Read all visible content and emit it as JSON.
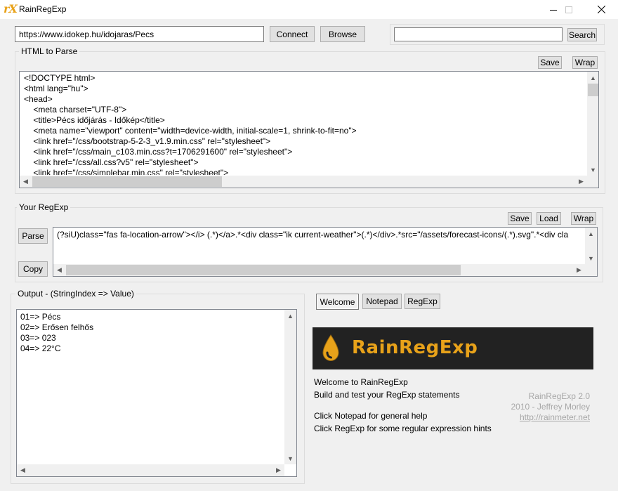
{
  "window": {
    "logo": "rX",
    "title": "RainRegExp"
  },
  "url_bar": {
    "value": "https://www.idokep.hu/idojaras/Pecs",
    "connect_label": "Connect",
    "browse_label": "Browse"
  },
  "search": {
    "value": "",
    "button_label": "Search"
  },
  "html_panel": {
    "label": "HTML to Parse",
    "save_label": "Save",
    "wrap_label": "Wrap",
    "lines": [
      "<!DOCTYPE html>",
      "<html lang=\"hu\">",
      "<head>",
      "    <meta charset=\"UTF-8\">",
      "    <title>Pécs időjárás - Időkép</title>",
      "    <meta name=\"viewport\" content=\"width=device-width, initial-scale=1, shrink-to-fit=no\">",
      "    <link href=\"/css/bootstrap-5-2-3_v1.9.min.css\" rel=\"stylesheet\">",
      "    <link href=\"/css/main_c103.min.css?t=1706291600\" rel=\"stylesheet\">",
      "    <link href=\"/css/all.css?v5\" rel=\"stylesheet\">",
      "    <link href=\"/css/simplebar.min.css\" rel=\"stylesheet\">"
    ]
  },
  "regexp_panel": {
    "label": "Your RegExp",
    "save_label": "Save",
    "load_label": "Load",
    "wrap_label": "Wrap",
    "parse_label": "Parse",
    "copy_label": "Copy",
    "value": "(?siU)class=\"fas fa-location-arrow\"></i> (.*)</a>.*<div class=\"ik current-weather\">(.*)</div>.*src=\"/assets/forecast-icons/(.*).svg\".*<div cla"
  },
  "output_panel": {
    "label": "Output - (StringIndex => Value)",
    "lines": [
      "01=> Pécs",
      "02=> Erősen felhős",
      "03=> 023",
      "04=> 22°C"
    ]
  },
  "tabs": [
    {
      "label": "Welcome"
    },
    {
      "label": "Notepad"
    },
    {
      "label": "RegExp"
    }
  ],
  "welcome": {
    "banner_text": "RainRegExp",
    "line1": "Welcome to RainRegExp",
    "line2": "Build and test your RegExp statements",
    "line3": "Click Notepad for general help",
    "line4": "Click RegExp for some regular expression hints",
    "credit_version": "RainRegExp 2.0",
    "credit_author": "2010 - Jeffrey Morley",
    "credit_link": "http://rainmeter.net"
  },
  "colors": {
    "accent": "#e8a21a",
    "focus_border": "#0078d7",
    "banner_bg": "#222222"
  }
}
